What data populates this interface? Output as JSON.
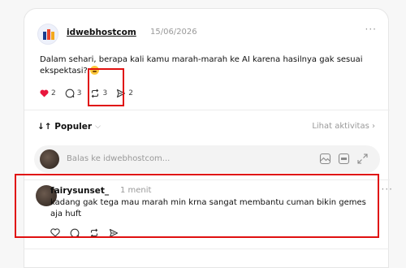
{
  "post": {
    "username": "idwebhostcom",
    "timestamp": "15/06/2026",
    "more_label": "···",
    "text": "Dalam sehari, berapa kali kamu marah-marah ke AI karena hasilnya gak sesuai ekspektasi?",
    "emoji_icon": "worried-face-emoji",
    "stats": {
      "likes": "2",
      "replies": "3",
      "reposts": "3",
      "shares": "2"
    },
    "like_color": "#e8163d"
  },
  "sort": {
    "label": "Populer",
    "activity_link": "Lihat aktivitas"
  },
  "reply_box": {
    "placeholder": "Balas ke idwebhostcom..."
  },
  "comment": {
    "username": "fairysunset_",
    "timestamp": "1 menit",
    "more_label": "···",
    "text": "kadang gak tega mau marah min krna sangat membantu cuman bikin gemes aja huft"
  },
  "highlight_color": "#e01010"
}
